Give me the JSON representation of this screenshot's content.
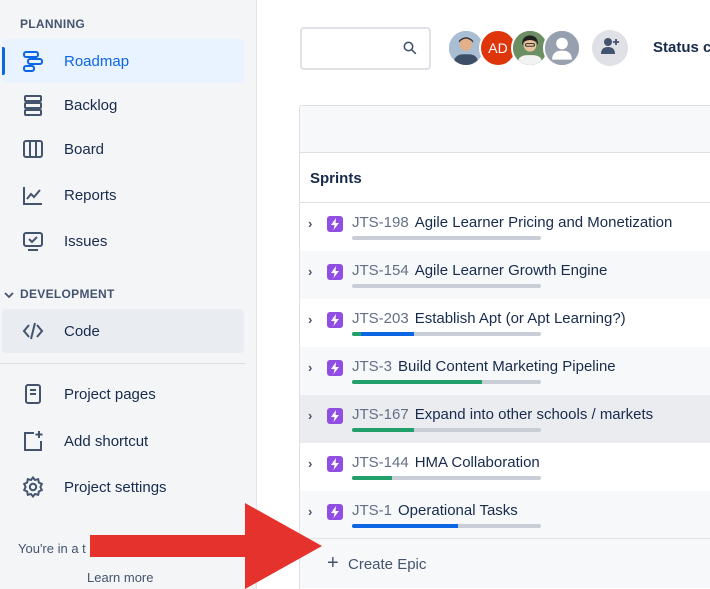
{
  "sidebar": {
    "planning_title": "PLANNING",
    "development_title": "DEVELOPMENT",
    "items": [
      {
        "label": "Roadmap",
        "icon": "roadmap-icon"
      },
      {
        "label": "Backlog",
        "icon": "backlog-icon"
      },
      {
        "label": "Board",
        "icon": "board-icon"
      },
      {
        "label": "Reports",
        "icon": "reports-icon"
      },
      {
        "label": "Issues",
        "icon": "issues-icon"
      },
      {
        "label": "Code",
        "icon": "code-icon"
      },
      {
        "label": "Project pages",
        "icon": "page-icon"
      },
      {
        "label": "Add shortcut",
        "icon": "add-shortcut-icon"
      },
      {
        "label": "Project settings",
        "icon": "gear-icon"
      }
    ],
    "footer_text": "You're in a t",
    "learn_more": "Learn more"
  },
  "topbar": {
    "search_placeholder": "",
    "avatars": [
      {
        "initials": "",
        "kind": "photo"
      },
      {
        "initials": "AD",
        "kind": "initials",
        "color": "#de350b"
      },
      {
        "initials": "",
        "kind": "photo"
      },
      {
        "initials": "",
        "kind": "default"
      }
    ],
    "status_label": "Status c"
  },
  "roadmap": {
    "sprints_label": "Sprints",
    "epics": [
      {
        "key": "JTS-198",
        "summary": "Agile Learner Pricing and Monetization",
        "done": 0.0,
        "in_progress": 0.0
      },
      {
        "key": "JTS-154",
        "summary": "Agile Learner Growth Engine",
        "done": 0.0,
        "in_progress": 0.0
      },
      {
        "key": "JTS-203",
        "summary": "Establish Apt (or Apt Learning?)",
        "done": 0.05,
        "in_progress": 0.28
      },
      {
        "key": "JTS-3",
        "summary": "Build Content Marketing Pipeline",
        "done": 0.69,
        "in_progress": 0.0
      },
      {
        "key": "JTS-167",
        "summary": "Expand into other schools / markets",
        "done": 0.33,
        "in_progress": 0.0
      },
      {
        "key": "JTS-144",
        "summary": "HMA Collaboration",
        "done": 0.21,
        "in_progress": 0.0
      },
      {
        "key": "JTS-1",
        "summary": "Operational Tasks",
        "done": 0.0,
        "in_progress": 0.56
      }
    ],
    "create_epic_label": "Create Epic"
  },
  "colors": {
    "accent": "#0c66e4",
    "epic": "#904ee2",
    "done": "#22a06b",
    "annotation_arrow": "#e5322d"
  }
}
